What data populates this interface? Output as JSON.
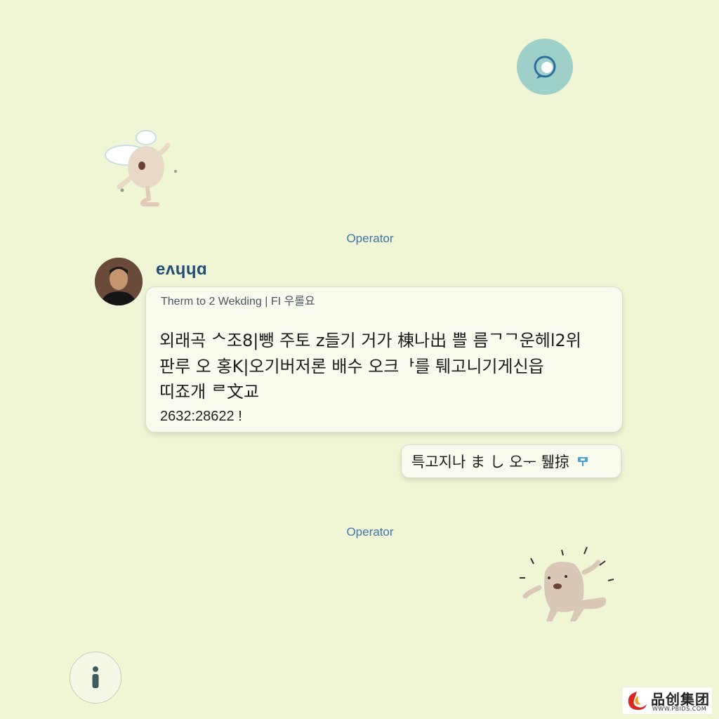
{
  "colors": {
    "background": "#f0f5d6",
    "accent": "#3f76a7",
    "badge": "#9fcfc9",
    "card": "#f9fbef"
  },
  "top_badge": {
    "icon": "chat-bubble-icon"
  },
  "operator_labels": [
    "Operator",
    "Operator"
  ],
  "message": {
    "sender_name": "eʌɥɥɑ",
    "subtitle": "Therm to 2 Wekding | FI 우롤요",
    "lines": [
      "외래곡 ᄉ조8|뺑  주토  z들기 거가  棟나出  쁠  름ᄀᄀ운헤l2위",
      "판루 오  홍K|오기버저론  배수  오크ᅡ를  퉤고니기게신읍",
      "띠죠개 ᄅ文교"
    ],
    "number": "2632:28622 !"
  },
  "reply": {
    "text": "특고지나  ま し 오ᅮ 퉲掠",
    "icon": "pin-icon"
  },
  "info_button": {
    "icon": "info-icon",
    "label": "i"
  },
  "watermark": {
    "name": "品创集团",
    "url": "WWW.PBIDS.COM"
  }
}
